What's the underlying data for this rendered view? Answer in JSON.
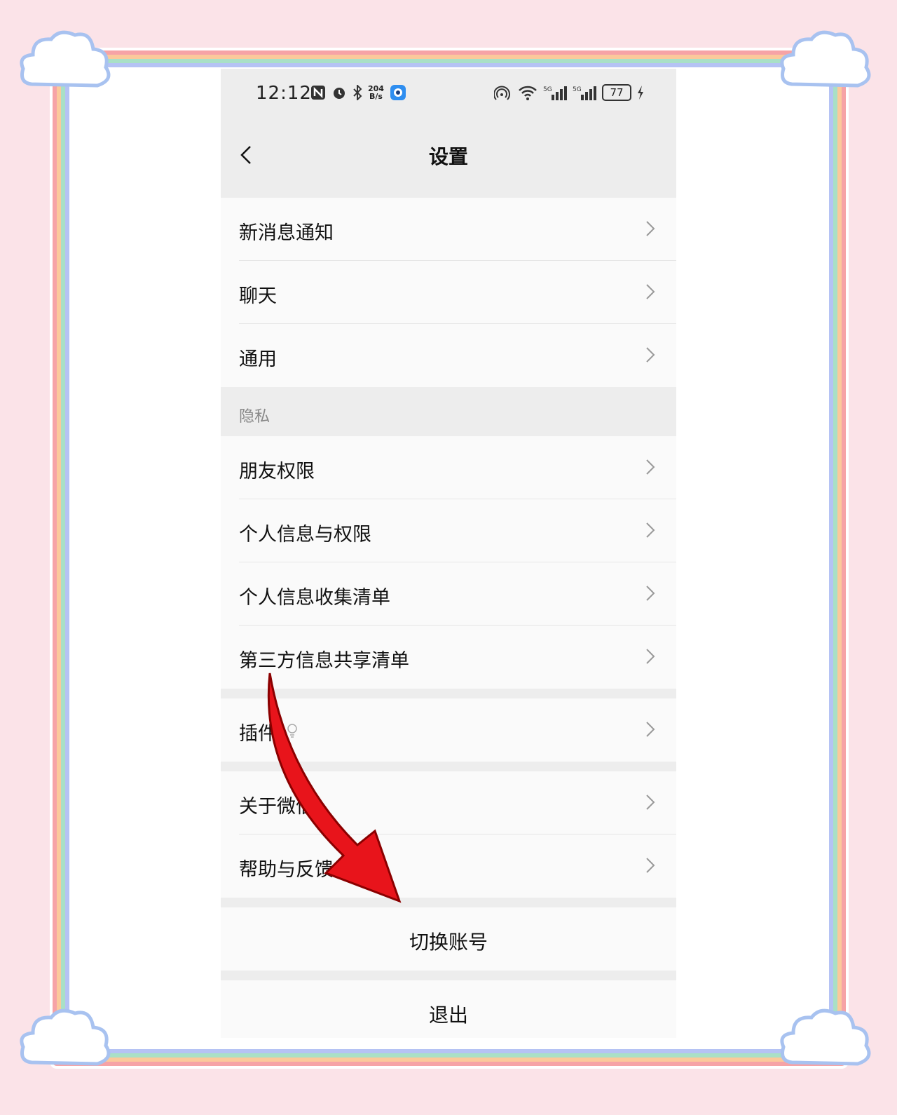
{
  "status_bar": {
    "time": "12:12",
    "net_speed_value": "204",
    "net_speed_unit": "B/s",
    "battery": "77",
    "signal_1": "5G",
    "signal_2": "5G",
    "hotspot_count": "2"
  },
  "nav": {
    "title": "设置"
  },
  "menu": {
    "group1": [
      "新消息通知",
      "聊天",
      "通用"
    ],
    "privacy_header": "隐私",
    "group2": [
      "朋友权限",
      "个人信息与权限",
      "个人信息收集清单",
      "第三方信息共享清单"
    ],
    "plugins": "插件",
    "group3": [
      "关于微信",
      "帮助与反馈"
    ],
    "switch_account": "切换账号",
    "logout": "退出"
  },
  "colors": {
    "arrow": "#e8141b",
    "frame_pink": "#f6a3a6",
    "frame_orange": "#fbc99b",
    "frame_green": "#a9e0c6",
    "frame_blue": "#b5c3f4",
    "page_bg": "#fbe3e8"
  },
  "icons": [
    "back-icon",
    "chevron-right-icon",
    "bulb-icon",
    "nfc-icon",
    "alarm-icon",
    "bluetooth-icon",
    "app-icon",
    "hotspot-icon",
    "wifi-icon",
    "signal-icon",
    "battery-icon",
    "charging-icon",
    "cloud-decoration",
    "red-arrow"
  ]
}
